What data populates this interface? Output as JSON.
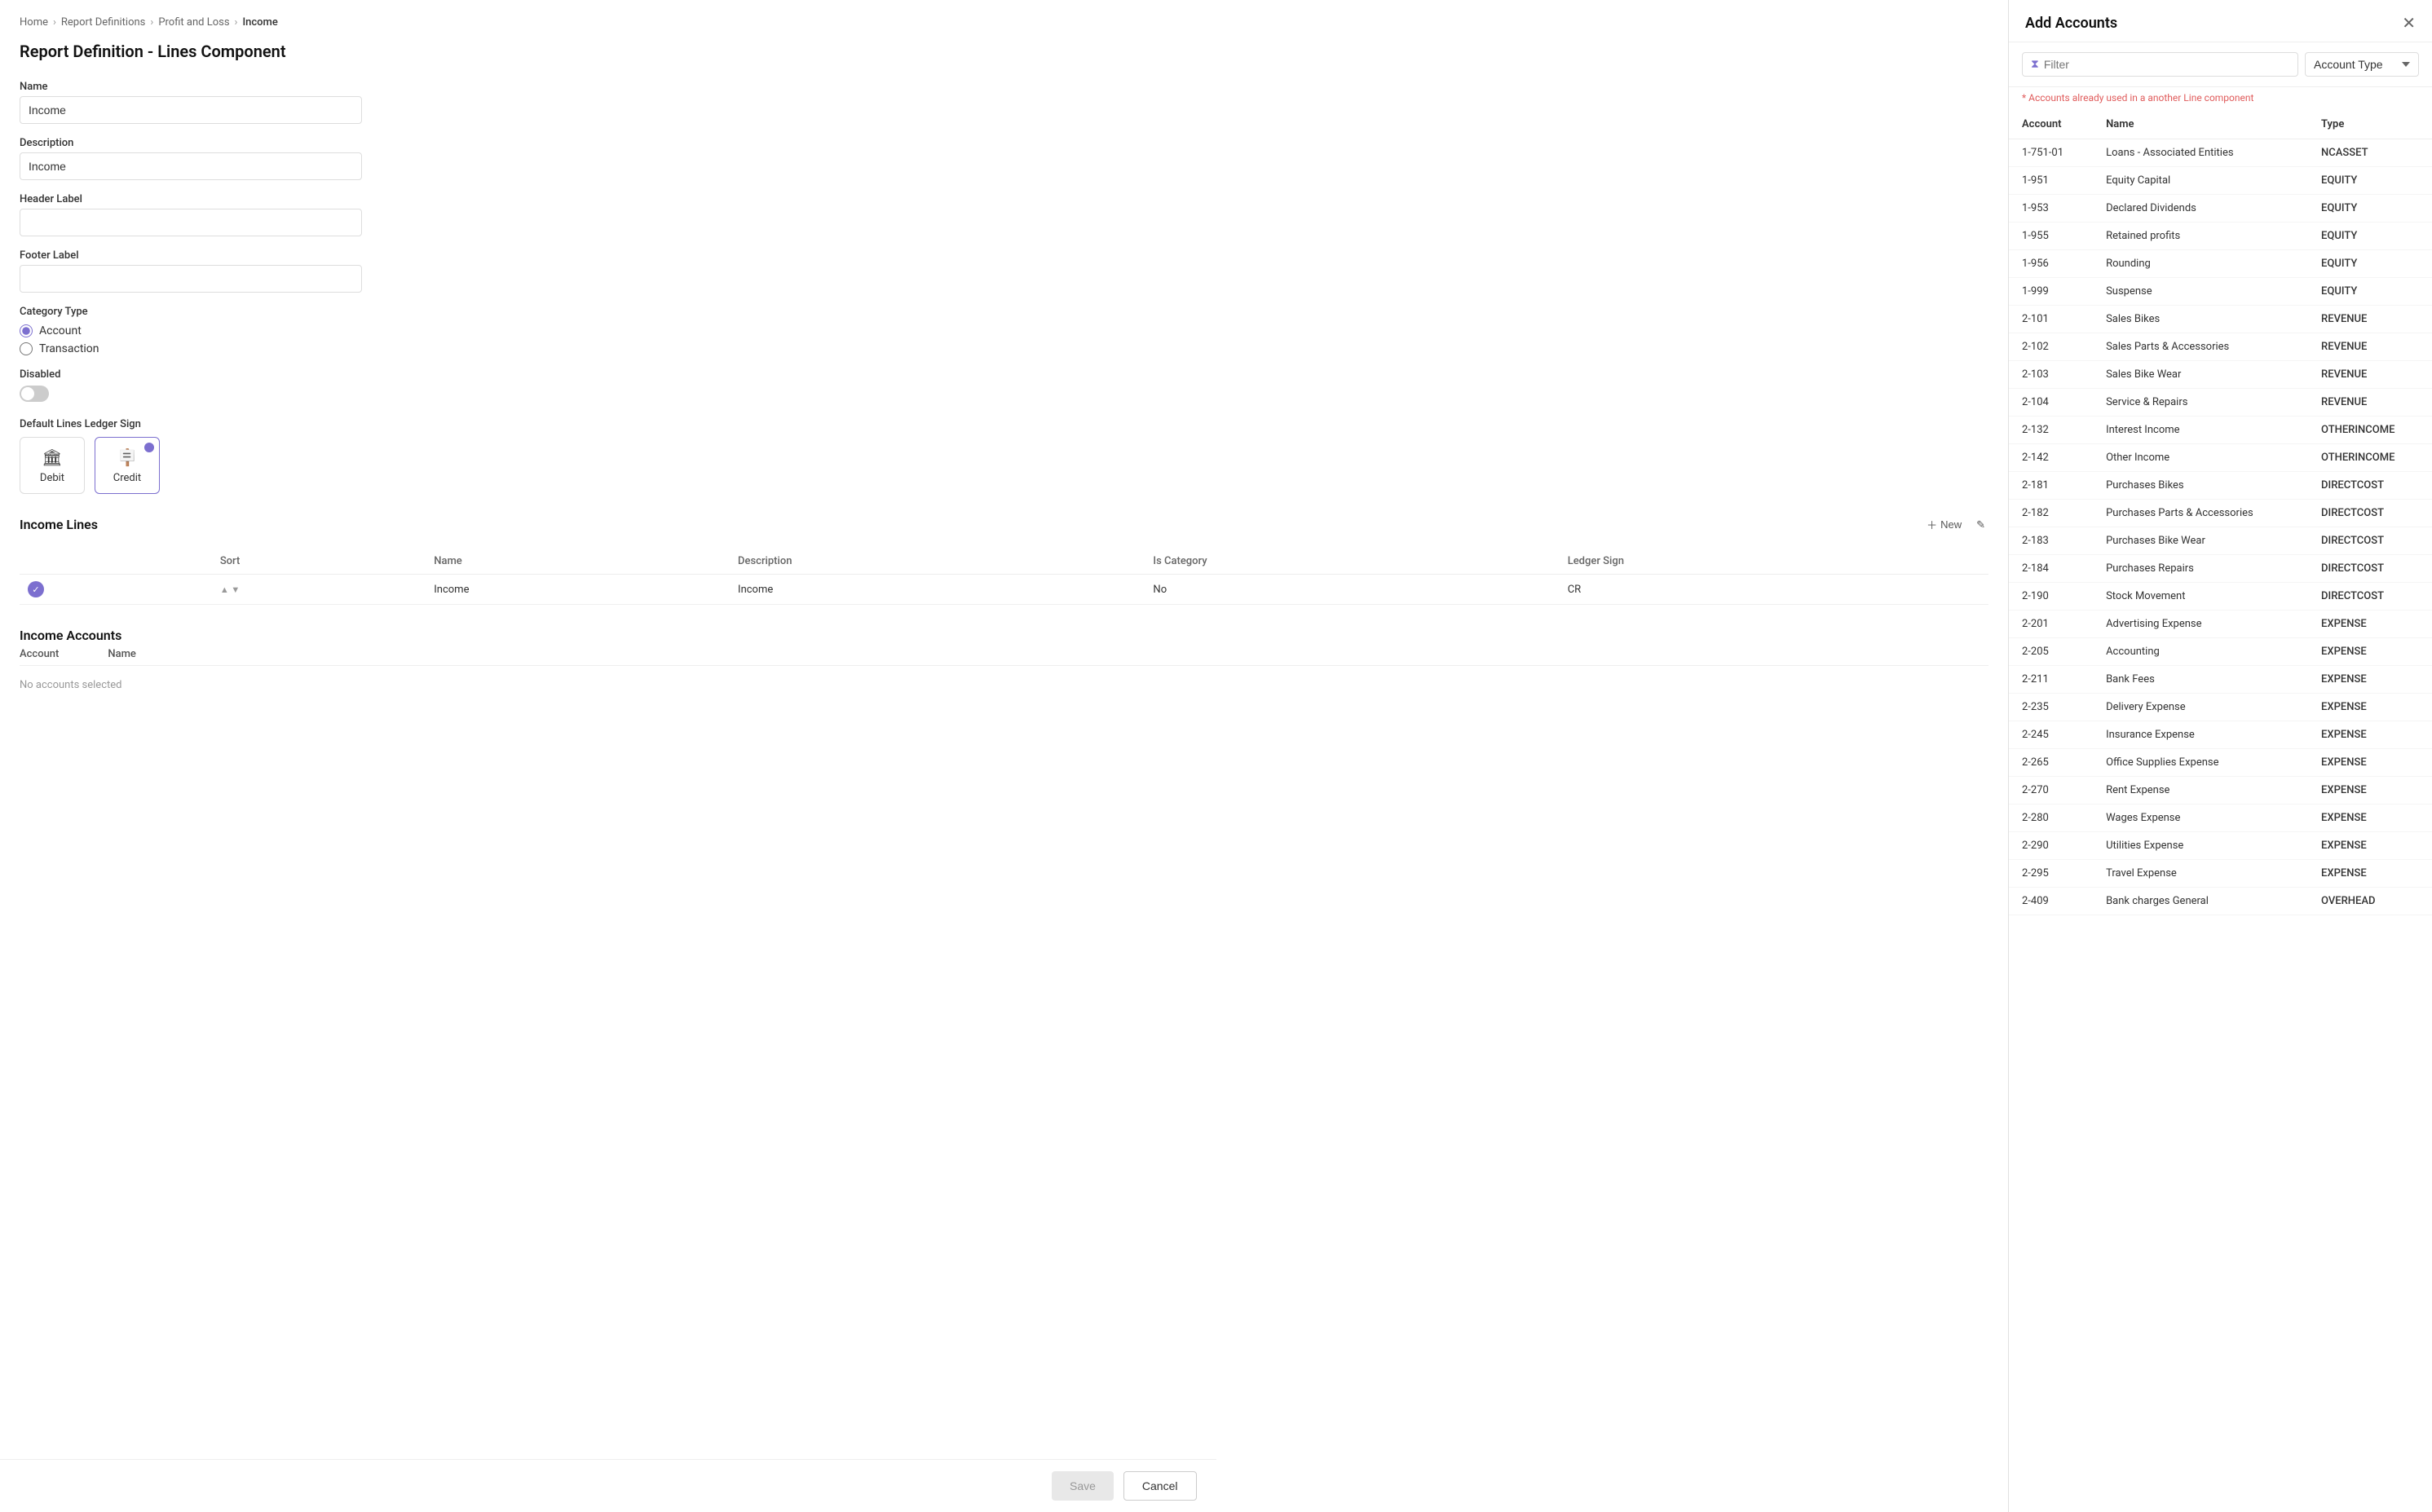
{
  "breadcrumb": {
    "home": "Home",
    "reportDefs": "Report Definitions",
    "profitLoss": "Profit and Loss",
    "income": "Income"
  },
  "page": {
    "title": "Report Definition - Lines Component"
  },
  "form": {
    "name_label": "Name",
    "name_value": "Income",
    "description_label": "Description",
    "description_value": "Income",
    "header_label_label": "Header Label",
    "header_label_value": "",
    "footer_label_label": "Footer Label",
    "footer_label_value": "",
    "category_type_label": "Category Type",
    "radio_account": "Account",
    "radio_transaction": "Transaction",
    "disabled_label": "Disabled",
    "ledger_sign_label": "Default Lines Ledger Sign",
    "debit_label": "Debit",
    "credit_label": "Credit"
  },
  "income_lines": {
    "section_title": "Income Lines",
    "new_label": "New",
    "columns": [
      "",
      "Sort",
      "Name",
      "Description",
      "Is Category",
      "Ledger Sign"
    ],
    "rows": [
      {
        "checked": true,
        "sort": "",
        "name": "Income",
        "description": "Income",
        "is_category": "No",
        "ledger_sign": "CR"
      }
    ]
  },
  "income_accounts": {
    "section_title": "Income Accounts",
    "col_account": "Account",
    "col_name": "Name",
    "no_accounts": "No accounts selected"
  },
  "buttons": {
    "save": "Save",
    "cancel": "Cancel"
  },
  "right_panel": {
    "title": "Add Accounts",
    "filter_placeholder": "Filter",
    "type_select_label": "Account Type",
    "warning": "* Accounts already used in a another Line component",
    "columns": [
      "Account",
      "Name",
      "Type"
    ],
    "accounts": [
      {
        "account": "1-751-01",
        "name": "Loans - Associated Entities",
        "type": "NCASSET"
      },
      {
        "account": "1-951",
        "name": "Equity Capital",
        "type": "EQUITY"
      },
      {
        "account": "1-953",
        "name": "Declared Dividends",
        "type": "EQUITY"
      },
      {
        "account": "1-955",
        "name": "Retained profits",
        "type": "EQUITY"
      },
      {
        "account": "1-956",
        "name": "Rounding",
        "type": "EQUITY"
      },
      {
        "account": "1-999",
        "name": "Suspense",
        "type": "EQUITY"
      },
      {
        "account": "2-101",
        "name": "Sales Bikes",
        "type": "REVENUE"
      },
      {
        "account": "2-102",
        "name": "Sales Parts & Accessories",
        "type": "REVENUE"
      },
      {
        "account": "2-103",
        "name": "Sales Bike Wear",
        "type": "REVENUE"
      },
      {
        "account": "2-104",
        "name": "Service & Repairs",
        "type": "REVENUE"
      },
      {
        "account": "2-132",
        "name": "Interest Income",
        "type": "OTHERINCOME"
      },
      {
        "account": "2-142",
        "name": "Other Income",
        "type": "OTHERINCOME"
      },
      {
        "account": "2-181",
        "name": "Purchases Bikes",
        "type": "DIRECTCOST"
      },
      {
        "account": "2-182",
        "name": "Purchases Parts & Accessories",
        "type": "DIRECTCOST"
      },
      {
        "account": "2-183",
        "name": "Purchases Bike Wear",
        "type": "DIRECTCOST"
      },
      {
        "account": "2-184",
        "name": "Purchases Repairs",
        "type": "DIRECTCOST"
      },
      {
        "account": "2-190",
        "name": "Stock Movement",
        "type": "DIRECTCOST"
      },
      {
        "account": "2-201",
        "name": "Advertising Expense",
        "type": "EXPENSE"
      },
      {
        "account": "2-205",
        "name": "Accounting",
        "type": "EXPENSE"
      },
      {
        "account": "2-211",
        "name": "Bank Fees",
        "type": "EXPENSE"
      },
      {
        "account": "2-235",
        "name": "Delivery Expense",
        "type": "EXPENSE"
      },
      {
        "account": "2-245",
        "name": "Insurance Expense",
        "type": "EXPENSE"
      },
      {
        "account": "2-265",
        "name": "Office Supplies Expense",
        "type": "EXPENSE"
      },
      {
        "account": "2-270",
        "name": "Rent Expense",
        "type": "EXPENSE"
      },
      {
        "account": "2-280",
        "name": "Wages Expense",
        "type": "EXPENSE"
      },
      {
        "account": "2-290",
        "name": "Utilities Expense",
        "type": "EXPENSE"
      },
      {
        "account": "2-295",
        "name": "Travel Expense",
        "type": "EXPENSE"
      },
      {
        "account": "2-409",
        "name": "Bank charges General",
        "type": "OVERHEAD"
      }
    ]
  }
}
